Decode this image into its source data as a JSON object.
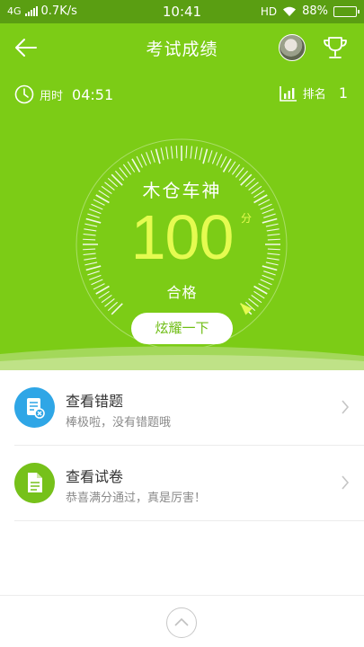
{
  "status": {
    "network": "4G",
    "speed": "0.7K/s",
    "time": "10:41",
    "hd": "HD",
    "battery": "88%",
    "battery_level": 0.88
  },
  "header": {
    "title": "考试成绩"
  },
  "stats": {
    "time_label": "用时",
    "time_value": "04:51",
    "rank_label": "排名",
    "rank_value": "1"
  },
  "result": {
    "name": "木仓车神",
    "score": "100",
    "unit": "分",
    "status": "合格",
    "score_fraction": 1.0
  },
  "share_label": "炫耀一下",
  "list": [
    {
      "title": "查看错题",
      "subtitle": "棒极啦，没有错题哦",
      "icon": "wrong-questions-icon",
      "color": "#2fa6e6"
    },
    {
      "title": "查看试卷",
      "subtitle": "恭喜满分通过，真是厉害！",
      "icon": "exam-paper-icon",
      "color": "#76c11a"
    }
  ],
  "colors": {
    "hero": "#7ccc16",
    "status_bar": "#5a9e12",
    "score": "#e5fb50"
  }
}
